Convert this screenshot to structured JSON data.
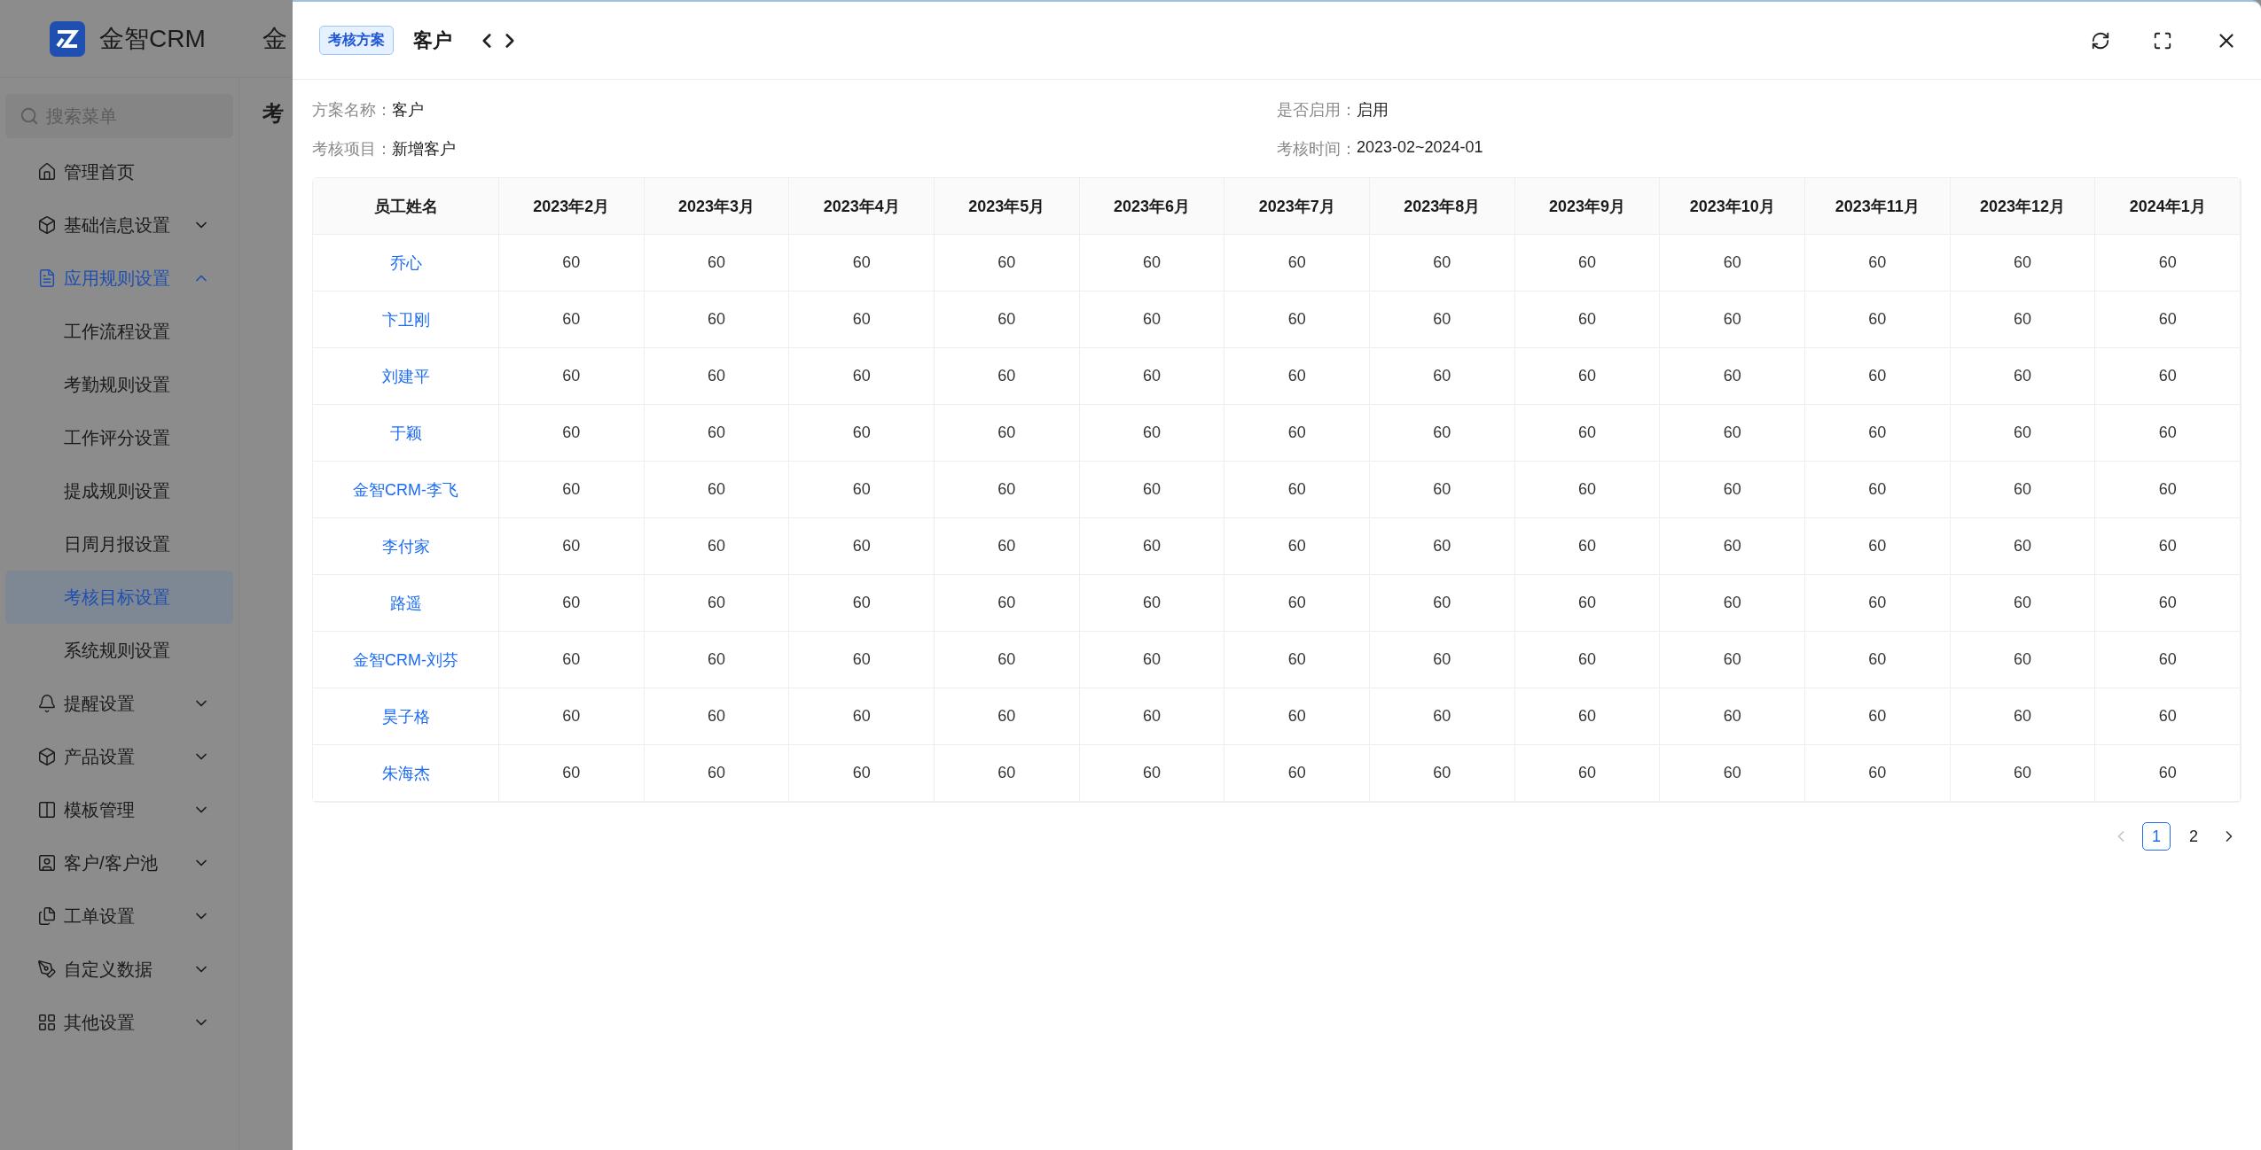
{
  "app": {
    "logo_text": "金智CRM",
    "header_title": "金",
    "page_title": "考"
  },
  "sidebar": {
    "search": {
      "placeholder": "搜索菜单"
    },
    "items": [
      {
        "kind": "link",
        "label": "管理首页"
      },
      {
        "kind": "group",
        "label": "基础信息设置",
        "expanded": false
      },
      {
        "kind": "group",
        "label": "应用规则设置",
        "expanded": true,
        "children": [
          {
            "label": "工作流程设置",
            "selected": false
          },
          {
            "label": "考勤规则设置",
            "selected": false
          },
          {
            "label": "工作评分设置",
            "selected": false
          },
          {
            "label": "提成规则设置",
            "selected": false
          },
          {
            "label": "日周月报设置",
            "selected": false
          },
          {
            "label": "考核目标设置",
            "selected": true
          },
          {
            "label": "系统规则设置",
            "selected": false
          }
        ]
      },
      {
        "kind": "group",
        "label": "提醒设置",
        "expanded": false
      },
      {
        "kind": "group",
        "label": "产品设置",
        "expanded": false
      },
      {
        "kind": "group",
        "label": "模板管理",
        "expanded": false
      },
      {
        "kind": "group",
        "label": "客户/客户池",
        "expanded": false
      },
      {
        "kind": "group",
        "label": "工单设置",
        "expanded": false
      },
      {
        "kind": "group",
        "label": "自定义数据",
        "expanded": false
      },
      {
        "kind": "group",
        "label": "其他设置",
        "expanded": false
      }
    ]
  },
  "drawer": {
    "tag": "考核方案",
    "title": "客户",
    "info": [
      {
        "label": "方案名称：",
        "value": "客户"
      },
      {
        "label": "是否启用：",
        "value": "启用"
      },
      {
        "label": "考核项目：",
        "value": "新增客户"
      },
      {
        "label": "考核时间：",
        "value": "2023-02~2024-01"
      }
    ],
    "table": {
      "columns": [
        "员工姓名",
        "2023年2月",
        "2023年3月",
        "2023年4月",
        "2023年5月",
        "2023年6月",
        "2023年7月",
        "2023年8月",
        "2023年9月",
        "2023年10月",
        "2023年11月",
        "2023年12月",
        "2024年1月"
      ],
      "rows": [
        {
          "name": "乔心",
          "values": [
            "60",
            "60",
            "60",
            "60",
            "60",
            "60",
            "60",
            "60",
            "60",
            "60",
            "60",
            "60"
          ]
        },
        {
          "name": "卞卫刚",
          "values": [
            "60",
            "60",
            "60",
            "60",
            "60",
            "60",
            "60",
            "60",
            "60",
            "60",
            "60",
            "60"
          ]
        },
        {
          "name": "刘建平",
          "values": [
            "60",
            "60",
            "60",
            "60",
            "60",
            "60",
            "60",
            "60",
            "60",
            "60",
            "60",
            "60"
          ]
        },
        {
          "name": "于颖",
          "values": [
            "60",
            "60",
            "60",
            "60",
            "60",
            "60",
            "60",
            "60",
            "60",
            "60",
            "60",
            "60"
          ]
        },
        {
          "name": "金智CRM-李飞",
          "values": [
            "60",
            "60",
            "60",
            "60",
            "60",
            "60",
            "60",
            "60",
            "60",
            "60",
            "60",
            "60"
          ]
        },
        {
          "name": "李付家",
          "values": [
            "60",
            "60",
            "60",
            "60",
            "60",
            "60",
            "60",
            "60",
            "60",
            "60",
            "60",
            "60"
          ]
        },
        {
          "name": "路遥",
          "values": [
            "60",
            "60",
            "60",
            "60",
            "60",
            "60",
            "60",
            "60",
            "60",
            "60",
            "60",
            "60"
          ]
        },
        {
          "name": "金智CRM-刘芬",
          "values": [
            "60",
            "60",
            "60",
            "60",
            "60",
            "60",
            "60",
            "60",
            "60",
            "60",
            "60",
            "60"
          ]
        },
        {
          "name": "昊子格",
          "values": [
            "60",
            "60",
            "60",
            "60",
            "60",
            "60",
            "60",
            "60",
            "60",
            "60",
            "60",
            "60"
          ]
        },
        {
          "name": "朱海杰",
          "values": [
            "60",
            "60",
            "60",
            "60",
            "60",
            "60",
            "60",
            "60",
            "60",
            "60",
            "60",
            "60"
          ]
        }
      ]
    },
    "pagination": {
      "prev_disabled": true,
      "next_disabled": false,
      "pages": [
        {
          "label": "1",
          "selected": true
        },
        {
          "label": "2",
          "selected": false
        }
      ]
    }
  }
}
